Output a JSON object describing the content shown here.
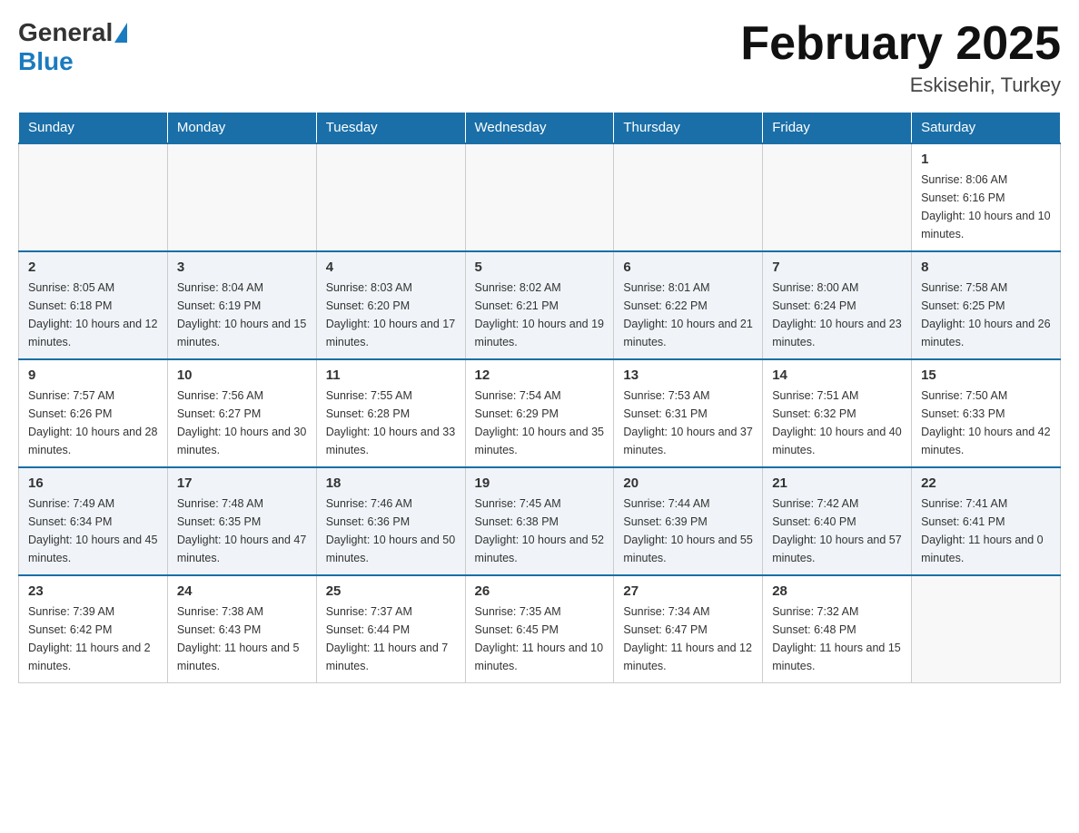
{
  "header": {
    "logo_general": "General",
    "logo_blue": "Blue",
    "month_title": "February 2025",
    "subtitle": "Eskisehir, Turkey"
  },
  "days_of_week": [
    "Sunday",
    "Monday",
    "Tuesday",
    "Wednesday",
    "Thursday",
    "Friday",
    "Saturday"
  ],
  "weeks": [
    [
      {
        "day": "",
        "sunrise": "",
        "sunset": "",
        "daylight": ""
      },
      {
        "day": "",
        "sunrise": "",
        "sunset": "",
        "daylight": ""
      },
      {
        "day": "",
        "sunrise": "",
        "sunset": "",
        "daylight": ""
      },
      {
        "day": "",
        "sunrise": "",
        "sunset": "",
        "daylight": ""
      },
      {
        "day": "",
        "sunrise": "",
        "sunset": "",
        "daylight": ""
      },
      {
        "day": "",
        "sunrise": "",
        "sunset": "",
        "daylight": ""
      },
      {
        "day": "1",
        "sunrise": "Sunrise: 8:06 AM",
        "sunset": "Sunset: 6:16 PM",
        "daylight": "Daylight: 10 hours and 10 minutes."
      }
    ],
    [
      {
        "day": "2",
        "sunrise": "Sunrise: 8:05 AM",
        "sunset": "Sunset: 6:18 PM",
        "daylight": "Daylight: 10 hours and 12 minutes."
      },
      {
        "day": "3",
        "sunrise": "Sunrise: 8:04 AM",
        "sunset": "Sunset: 6:19 PM",
        "daylight": "Daylight: 10 hours and 15 minutes."
      },
      {
        "day": "4",
        "sunrise": "Sunrise: 8:03 AM",
        "sunset": "Sunset: 6:20 PM",
        "daylight": "Daylight: 10 hours and 17 minutes."
      },
      {
        "day": "5",
        "sunrise": "Sunrise: 8:02 AM",
        "sunset": "Sunset: 6:21 PM",
        "daylight": "Daylight: 10 hours and 19 minutes."
      },
      {
        "day": "6",
        "sunrise": "Sunrise: 8:01 AM",
        "sunset": "Sunset: 6:22 PM",
        "daylight": "Daylight: 10 hours and 21 minutes."
      },
      {
        "day": "7",
        "sunrise": "Sunrise: 8:00 AM",
        "sunset": "Sunset: 6:24 PM",
        "daylight": "Daylight: 10 hours and 23 minutes."
      },
      {
        "day": "8",
        "sunrise": "Sunrise: 7:58 AM",
        "sunset": "Sunset: 6:25 PM",
        "daylight": "Daylight: 10 hours and 26 minutes."
      }
    ],
    [
      {
        "day": "9",
        "sunrise": "Sunrise: 7:57 AM",
        "sunset": "Sunset: 6:26 PM",
        "daylight": "Daylight: 10 hours and 28 minutes."
      },
      {
        "day": "10",
        "sunrise": "Sunrise: 7:56 AM",
        "sunset": "Sunset: 6:27 PM",
        "daylight": "Daylight: 10 hours and 30 minutes."
      },
      {
        "day": "11",
        "sunrise": "Sunrise: 7:55 AM",
        "sunset": "Sunset: 6:28 PM",
        "daylight": "Daylight: 10 hours and 33 minutes."
      },
      {
        "day": "12",
        "sunrise": "Sunrise: 7:54 AM",
        "sunset": "Sunset: 6:29 PM",
        "daylight": "Daylight: 10 hours and 35 minutes."
      },
      {
        "day": "13",
        "sunrise": "Sunrise: 7:53 AM",
        "sunset": "Sunset: 6:31 PM",
        "daylight": "Daylight: 10 hours and 37 minutes."
      },
      {
        "day": "14",
        "sunrise": "Sunrise: 7:51 AM",
        "sunset": "Sunset: 6:32 PM",
        "daylight": "Daylight: 10 hours and 40 minutes."
      },
      {
        "day": "15",
        "sunrise": "Sunrise: 7:50 AM",
        "sunset": "Sunset: 6:33 PM",
        "daylight": "Daylight: 10 hours and 42 minutes."
      }
    ],
    [
      {
        "day": "16",
        "sunrise": "Sunrise: 7:49 AM",
        "sunset": "Sunset: 6:34 PM",
        "daylight": "Daylight: 10 hours and 45 minutes."
      },
      {
        "day": "17",
        "sunrise": "Sunrise: 7:48 AM",
        "sunset": "Sunset: 6:35 PM",
        "daylight": "Daylight: 10 hours and 47 minutes."
      },
      {
        "day": "18",
        "sunrise": "Sunrise: 7:46 AM",
        "sunset": "Sunset: 6:36 PM",
        "daylight": "Daylight: 10 hours and 50 minutes."
      },
      {
        "day": "19",
        "sunrise": "Sunrise: 7:45 AM",
        "sunset": "Sunset: 6:38 PM",
        "daylight": "Daylight: 10 hours and 52 minutes."
      },
      {
        "day": "20",
        "sunrise": "Sunrise: 7:44 AM",
        "sunset": "Sunset: 6:39 PM",
        "daylight": "Daylight: 10 hours and 55 minutes."
      },
      {
        "day": "21",
        "sunrise": "Sunrise: 7:42 AM",
        "sunset": "Sunset: 6:40 PM",
        "daylight": "Daylight: 10 hours and 57 minutes."
      },
      {
        "day": "22",
        "sunrise": "Sunrise: 7:41 AM",
        "sunset": "Sunset: 6:41 PM",
        "daylight": "Daylight: 11 hours and 0 minutes."
      }
    ],
    [
      {
        "day": "23",
        "sunrise": "Sunrise: 7:39 AM",
        "sunset": "Sunset: 6:42 PM",
        "daylight": "Daylight: 11 hours and 2 minutes."
      },
      {
        "day": "24",
        "sunrise": "Sunrise: 7:38 AM",
        "sunset": "Sunset: 6:43 PM",
        "daylight": "Daylight: 11 hours and 5 minutes."
      },
      {
        "day": "25",
        "sunrise": "Sunrise: 7:37 AM",
        "sunset": "Sunset: 6:44 PM",
        "daylight": "Daylight: 11 hours and 7 minutes."
      },
      {
        "day": "26",
        "sunrise": "Sunrise: 7:35 AM",
        "sunset": "Sunset: 6:45 PM",
        "daylight": "Daylight: 11 hours and 10 minutes."
      },
      {
        "day": "27",
        "sunrise": "Sunrise: 7:34 AM",
        "sunset": "Sunset: 6:47 PM",
        "daylight": "Daylight: 11 hours and 12 minutes."
      },
      {
        "day": "28",
        "sunrise": "Sunrise: 7:32 AM",
        "sunset": "Sunset: 6:48 PM",
        "daylight": "Daylight: 11 hours and 15 minutes."
      },
      {
        "day": "",
        "sunrise": "",
        "sunset": "",
        "daylight": ""
      }
    ]
  ]
}
